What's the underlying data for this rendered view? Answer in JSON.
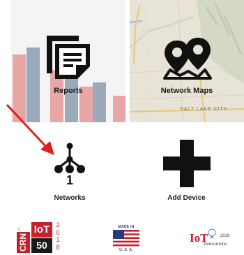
{
  "tiles": {
    "reports": {
      "label": "Reports",
      "icon": "report-document-icon"
    },
    "network_maps": {
      "label": "Network Maps",
      "icon": "map-pins-icon",
      "map_city_label": "SALT LAKE CITY"
    }
  },
  "actions": {
    "networks": {
      "label": "Networks",
      "count": "1",
      "icon": "network-tree-icon"
    },
    "add_device": {
      "label": "Add Device",
      "icon": "plus-icon"
    }
  },
  "badges": {
    "crn": {
      "brand_small": "THE CHANNEL CO.",
      "brand": "CRN",
      "iot": "IoT",
      "rank": "50",
      "year_digits": [
        "2",
        "0",
        "1",
        "8"
      ]
    },
    "made_in_usa": {
      "line1": "MADE IN",
      "line2": "U. S. A."
    },
    "iot_innovations": {
      "iot": "IoT",
      "word": "Innovations",
      "year": "2018"
    }
  },
  "colors": {
    "arrow": "#e02020",
    "bar_red": "#e8a6a6",
    "bar_blue": "#9aaabb",
    "crn_red": "#c8202a",
    "usa_blue": "#2b3a7a"
  }
}
